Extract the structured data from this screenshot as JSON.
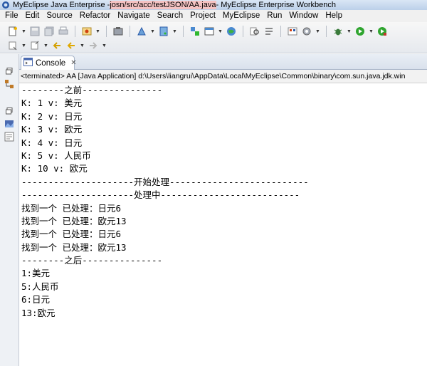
{
  "window": {
    "title_prefix": "MyEclipse Java Enterprise - ",
    "title_path": "josn/src/acc/testJSON/AA.java",
    "title_suffix": " - MyEclipse Enterprise Workbench"
  },
  "menubar": {
    "items": [
      "File",
      "Edit",
      "Source",
      "Refactor",
      "Navigate",
      "Search",
      "Project",
      "MyEclipse",
      "Run",
      "Window",
      "Help"
    ]
  },
  "toolbar": {
    "row1_icons": [
      "new-icon",
      "save-icon",
      "save-all-icon",
      "print-icon",
      "open-type-icon",
      "build-icon",
      "deploy-icon",
      "server-icon",
      "new-server-icon",
      "open-perspective-icon",
      "search-icon",
      "open-task-icon",
      "web-browser-icon",
      "debug-icon",
      "run-icon",
      "external-tools-icon"
    ],
    "row2_icons": [
      "next-annotation-icon",
      "previous-annotation-icon",
      "last-edit-icon",
      "back-icon",
      "forward-icon"
    ]
  },
  "console": {
    "tab_label": "Console",
    "status": "<terminated> AA [Java Application] d:\\Users\\liangrui\\AppData\\Local\\MyEclipse\\Common\\binary\\com.sun.java.jdk.win",
    "lines": [
      "--------之前---------------",
      "K: 1 v: 美元",
      "K: 2 v: 日元",
      "K: 3 v: 欧元",
      "K: 4 v: 日元",
      "K: 5 v: 人民币",
      "K: 10 v: 欧元",
      "---------------------开始处理--------------------------",
      "---------------------处理中--------------------------",
      "找到一个 已处理：日元6",
      "找到一个 已处理：欧元13",
      "找到一个 已处理：日元6",
      "找到一个 已处理：欧元13",
      "--------之后---------------",
      "1:美元",
      "5:人民币",
      "6:日元",
      "13:欧元"
    ]
  },
  "colors": {
    "title_path_highlight": "#f4c2c2",
    "toolbar_bg": "#e6e9ee",
    "tab_border": "#a8b5c8"
  }
}
